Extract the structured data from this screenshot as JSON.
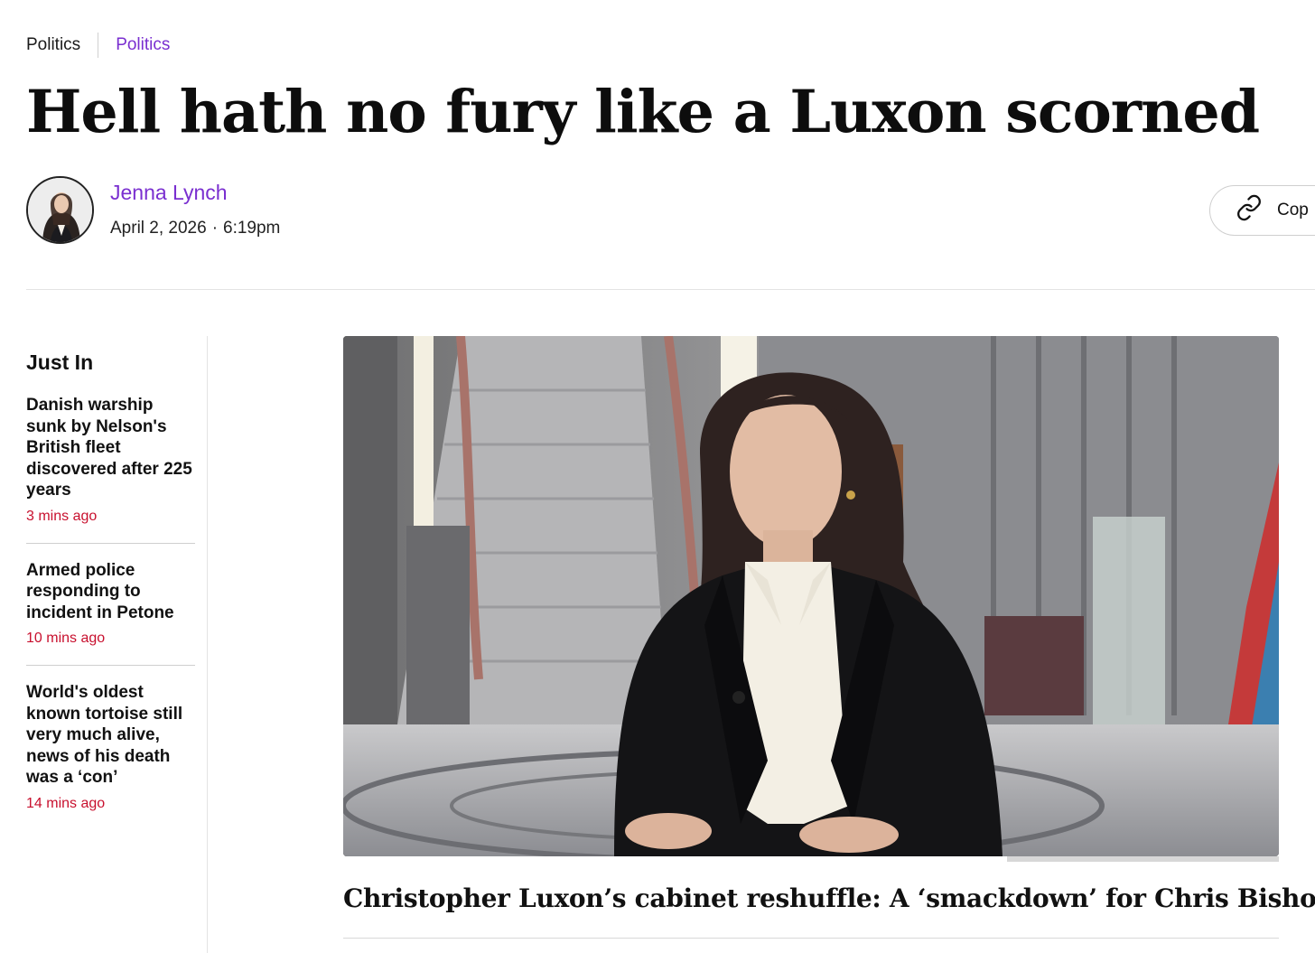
{
  "breadcrumb": {
    "section": "Politics",
    "subsection": "Politics"
  },
  "article": {
    "headline": "Hell hath no fury like a Luxon scorned",
    "author": "Jenna Lynch",
    "date": "April 2, 2026",
    "separator": "·",
    "time": "6:19pm",
    "copy_label": "Cop",
    "copy_icon": "link-icon",
    "video_caption": "Christopher Luxon’s cabinet reshuffle: A ‘smackdown’ for Chris Bishop"
  },
  "sidebar": {
    "title": "Just In",
    "items": [
      {
        "headline": "Danish warship sunk by Nelson's British fleet discovered after 225 years",
        "time": "3 mins ago"
      },
      {
        "headline": "Armed police responding to incident in Petone",
        "time": "10 mins ago"
      },
      {
        "headline": "World's oldest known tortoise still very much alive, news of his death was a ‘con’",
        "time": "14 mins ago"
      }
    ]
  },
  "colors": {
    "accent": "#7a2fd0",
    "timestamp": "#c8102e"
  }
}
